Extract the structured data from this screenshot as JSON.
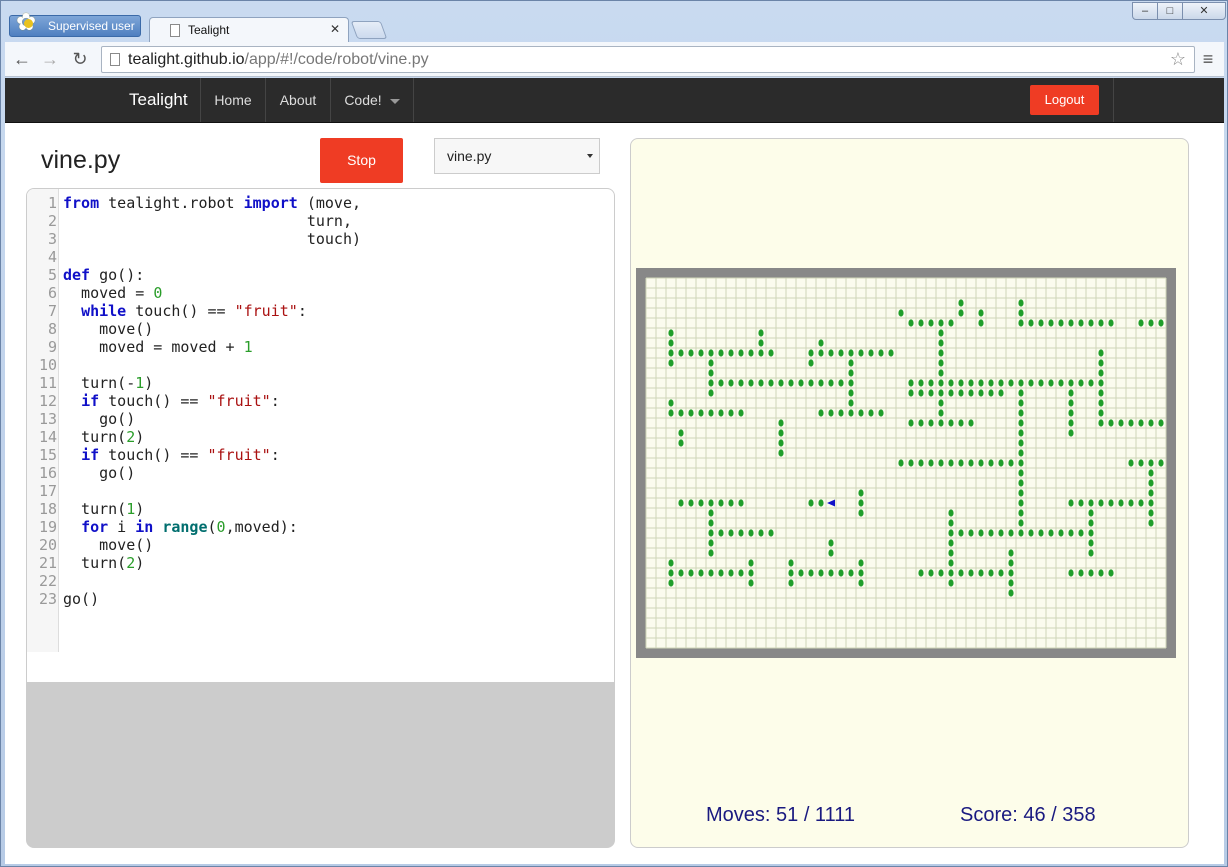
{
  "browser": {
    "profile_label": "Supervised user",
    "tab_title": "Tealight",
    "url_host": "tealight.github.io",
    "url_path": "/app/#!/code/robot/vine.py"
  },
  "navbar": {
    "brand": "Tealight",
    "home": "Home",
    "about": "About",
    "code": "Code!",
    "logout": "Logout"
  },
  "editor": {
    "file_title": "vine.py",
    "stop_label": "Stop",
    "file_selected": "vine.py",
    "lines": [
      "from tealight.robot import (move,",
      "                           turn,",
      "                           touch)",
      "",
      "def go():",
      "  moved = 0",
      "  while touch() == \"fruit\":",
      "    move()",
      "    moved = moved + 1",
      "",
      "  turn(-1)",
      "  if touch() == \"fruit\":",
      "    go()",
      "  turn(2)",
      "  if touch() == \"fruit\":",
      "    go()",
      "",
      "  turn(1)",
      "  for i in range(0,moved):",
      "    move()",
      "  turn(2)",
      "",
      "go()"
    ]
  },
  "world": {
    "moves_text": "Moves: 51 / 1111",
    "score_text": "Score: 46 / 358",
    "grid_cols": 52,
    "grid_rows": 37,
    "robot": {
      "col": 18,
      "row": 22,
      "facing": "left"
    },
    "fruit_runs": [
      [
        15,
        3,
        16,
        3
      ],
      [
        15,
        13,
        16,
        13
      ],
      [
        10,
        26,
        11,
        35
      ],
      [
        11,
        26,
        11,
        29
      ],
      [
        11,
        30,
        11,
        34
      ],
      [
        3,
        33,
        3,
        33
      ],
      [
        4,
        26,
        4,
        30
      ],
      [
        4,
        33,
        4,
        33
      ],
      [
        4,
        37,
        4,
        46
      ],
      [
        4,
        39,
        4,
        39
      ],
      [
        4,
        45,
        4,
        45
      ],
      [
        4,
        49,
        4,
        49
      ],
      [
        4,
        50,
        4,
        51
      ],
      [
        5,
        2,
        5,
        2
      ],
      [
        5,
        11,
        5,
        11
      ],
      [
        5,
        29,
        5,
        29
      ],
      [
        6,
        2,
        6,
        2
      ],
      [
        6,
        11,
        6,
        11
      ],
      [
        6,
        17,
        6,
        17
      ],
      [
        6,
        29,
        6,
        29
      ],
      [
        7,
        2,
        7,
        12
      ],
      [
        7,
        16,
        7,
        24
      ],
      [
        7,
        29,
        7,
        29
      ],
      [
        7,
        45,
        7,
        45
      ],
      [
        8,
        2,
        8,
        2
      ],
      [
        8,
        6,
        8,
        6
      ],
      [
        8,
        16,
        8,
        16
      ],
      [
        8,
        20,
        8,
        20
      ],
      [
        8,
        29,
        8,
        29
      ],
      [
        8,
        45,
        8,
        45
      ],
      [
        9,
        6,
        9,
        6
      ],
      [
        9,
        20,
        9,
        20
      ],
      [
        9,
        29,
        9,
        29
      ],
      [
        9,
        45,
        9,
        45
      ],
      [
        10,
        6,
        10,
        20
      ],
      [
        10,
        29,
        10,
        45
      ],
      [
        11,
        6,
        11,
        6
      ],
      [
        11,
        20,
        11,
        20
      ],
      [
        11,
        29,
        11,
        29
      ],
      [
        11,
        37,
        11,
        37
      ],
      [
        11,
        42,
        11,
        42
      ],
      [
        11,
        45,
        11,
        45
      ],
      [
        12,
        2,
        12,
        2
      ],
      [
        12,
        20,
        12,
        20
      ],
      [
        12,
        29,
        12,
        29
      ],
      [
        12,
        37,
        12,
        37
      ],
      [
        12,
        42,
        12,
        42
      ],
      [
        12,
        45,
        12,
        45
      ],
      [
        13,
        2,
        13,
        9
      ],
      [
        13,
        17,
        13,
        23
      ],
      [
        13,
        29,
        13,
        29
      ],
      [
        13,
        37,
        13,
        37
      ],
      [
        13,
        42,
        13,
        42
      ],
      [
        13,
        45,
        13,
        45
      ],
      [
        14,
        13,
        14,
        13
      ],
      [
        14,
        26,
        14,
        32
      ],
      [
        14,
        37,
        14,
        37
      ],
      [
        14,
        42,
        14,
        42
      ],
      [
        14,
        45,
        14,
        51
      ],
      [
        15,
        13,
        15,
        13
      ],
      [
        15,
        37,
        15,
        37
      ],
      [
        15,
        42,
        15,
        42
      ],
      [
        16,
        13,
        16,
        13
      ],
      [
        16,
        37,
        16,
        37
      ],
      [
        17,
        13,
        17,
        13
      ],
      [
        17,
        37,
        17,
        37
      ],
      [
        18,
        25,
        18,
        37
      ],
      [
        18,
        48,
        18,
        51
      ],
      [
        19,
        37,
        19,
        37
      ],
      [
        19,
        50,
        19,
        50
      ],
      [
        20,
        37,
        20,
        37
      ],
      [
        20,
        50,
        20,
        50
      ],
      [
        21,
        21,
        21,
        21
      ],
      [
        21,
        37,
        21,
        37
      ],
      [
        21,
        50,
        21,
        50
      ],
      [
        22,
        3,
        22,
        9
      ],
      [
        22,
        16,
        22,
        18
      ],
      [
        22,
        21,
        22,
        21
      ],
      [
        22,
        37,
        22,
        37
      ],
      [
        22,
        42,
        22,
        50
      ],
      [
        23,
        6,
        23,
        6
      ],
      [
        23,
        21,
        23,
        21
      ],
      [
        23,
        30,
        23,
        30
      ],
      [
        23,
        37,
        23,
        37
      ],
      [
        23,
        44,
        23,
        44
      ],
      [
        23,
        50,
        23,
        50
      ],
      [
        24,
        6,
        24,
        6
      ],
      [
        24,
        30,
        24,
        30
      ],
      [
        24,
        37,
        24,
        37
      ],
      [
        24,
        44,
        24,
        44
      ],
      [
        24,
        50,
        24,
        50
      ],
      [
        25,
        6,
        25,
        12
      ],
      [
        25,
        30,
        25,
        44
      ],
      [
        26,
        6,
        26,
        6
      ],
      [
        26,
        18,
        26,
        18
      ],
      [
        26,
        30,
        26,
        30
      ],
      [
        26,
        44,
        26,
        44
      ],
      [
        27,
        6,
        27,
        6
      ],
      [
        27,
        18,
        27,
        18
      ],
      [
        27,
        30,
        27,
        30
      ],
      [
        27,
        36,
        27,
        36
      ],
      [
        27,
        44,
        27,
        44
      ],
      [
        28,
        2,
        28,
        2
      ],
      [
        28,
        10,
        28,
        10
      ],
      [
        28,
        14,
        28,
        14
      ],
      [
        28,
        21,
        28,
        21
      ],
      [
        28,
        30,
        28,
        30
      ],
      [
        28,
        36,
        28,
        36
      ],
      [
        29,
        2,
        29,
        10
      ],
      [
        29,
        14,
        29,
        21
      ],
      [
        29,
        27,
        29,
        36
      ],
      [
        29,
        42,
        29,
        46
      ],
      [
        30,
        2,
        30,
        2
      ],
      [
        30,
        10,
        30,
        10
      ],
      [
        30,
        14,
        30,
        14
      ],
      [
        30,
        21,
        30,
        21
      ],
      [
        30,
        30,
        30,
        30
      ],
      [
        30,
        36,
        30,
        36
      ],
      [
        31,
        36,
        31,
        36
      ],
      [
        2,
        31,
        3,
        31
      ],
      [
        3,
        25,
        3,
        25
      ],
      [
        3,
        37,
        3,
        37
      ],
      [
        2,
        37,
        2,
        37
      ]
    ]
  },
  "colors": {
    "accent": "#ef3c24",
    "fruit": "#1f9e2a",
    "robot": "#1010c8",
    "wall": "#888888"
  }
}
